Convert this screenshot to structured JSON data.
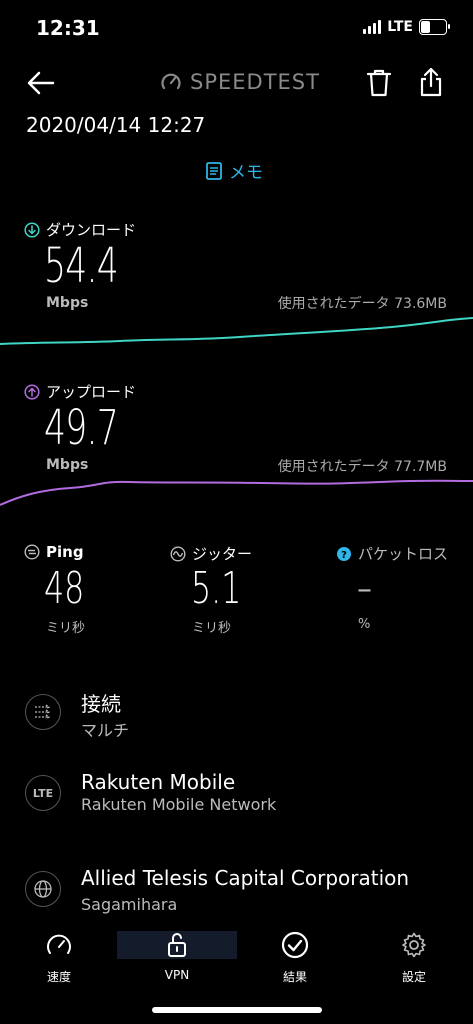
{
  "status": {
    "time": "12:31",
    "network": "LTE"
  },
  "header": {
    "logo": "SPEEDTEST",
    "date": "2020/04/14 12:27",
    "memo": "メモ"
  },
  "download": {
    "label": "ダウンロード",
    "value": "54.4",
    "unit": "Mbps",
    "used": "使用されたデータ 73.6MB",
    "color": "#3fd4c4"
  },
  "upload": {
    "label": "アップロード",
    "value": "49.7",
    "unit": "Mbps",
    "used": "使用されたデータ 77.7MB",
    "color": "#b36be0"
  },
  "metrics": {
    "ping": {
      "label": "Ping",
      "value": "48",
      "unit": "ミリ秒"
    },
    "jitter": {
      "label": "ジッター",
      "value": "5.1",
      "unit": "ミリ秒"
    },
    "loss": {
      "label": "パケットロス",
      "value": "–",
      "unit": "%"
    }
  },
  "info": [
    {
      "icon": "connections-icon",
      "title": "接続",
      "sub": "マルチ"
    },
    {
      "icon": "lte-icon",
      "badge": "LTE",
      "title": "Rakuten Mobile",
      "sub": "Rakuten Mobile Network"
    },
    {
      "icon": "globe-icon",
      "title": "Allied Telesis Capital Corporation",
      "sub": "Sagamihara"
    }
  ],
  "nav": {
    "speed": "速度",
    "vpn": "VPN",
    "results": "結果",
    "settings": "設定"
  }
}
